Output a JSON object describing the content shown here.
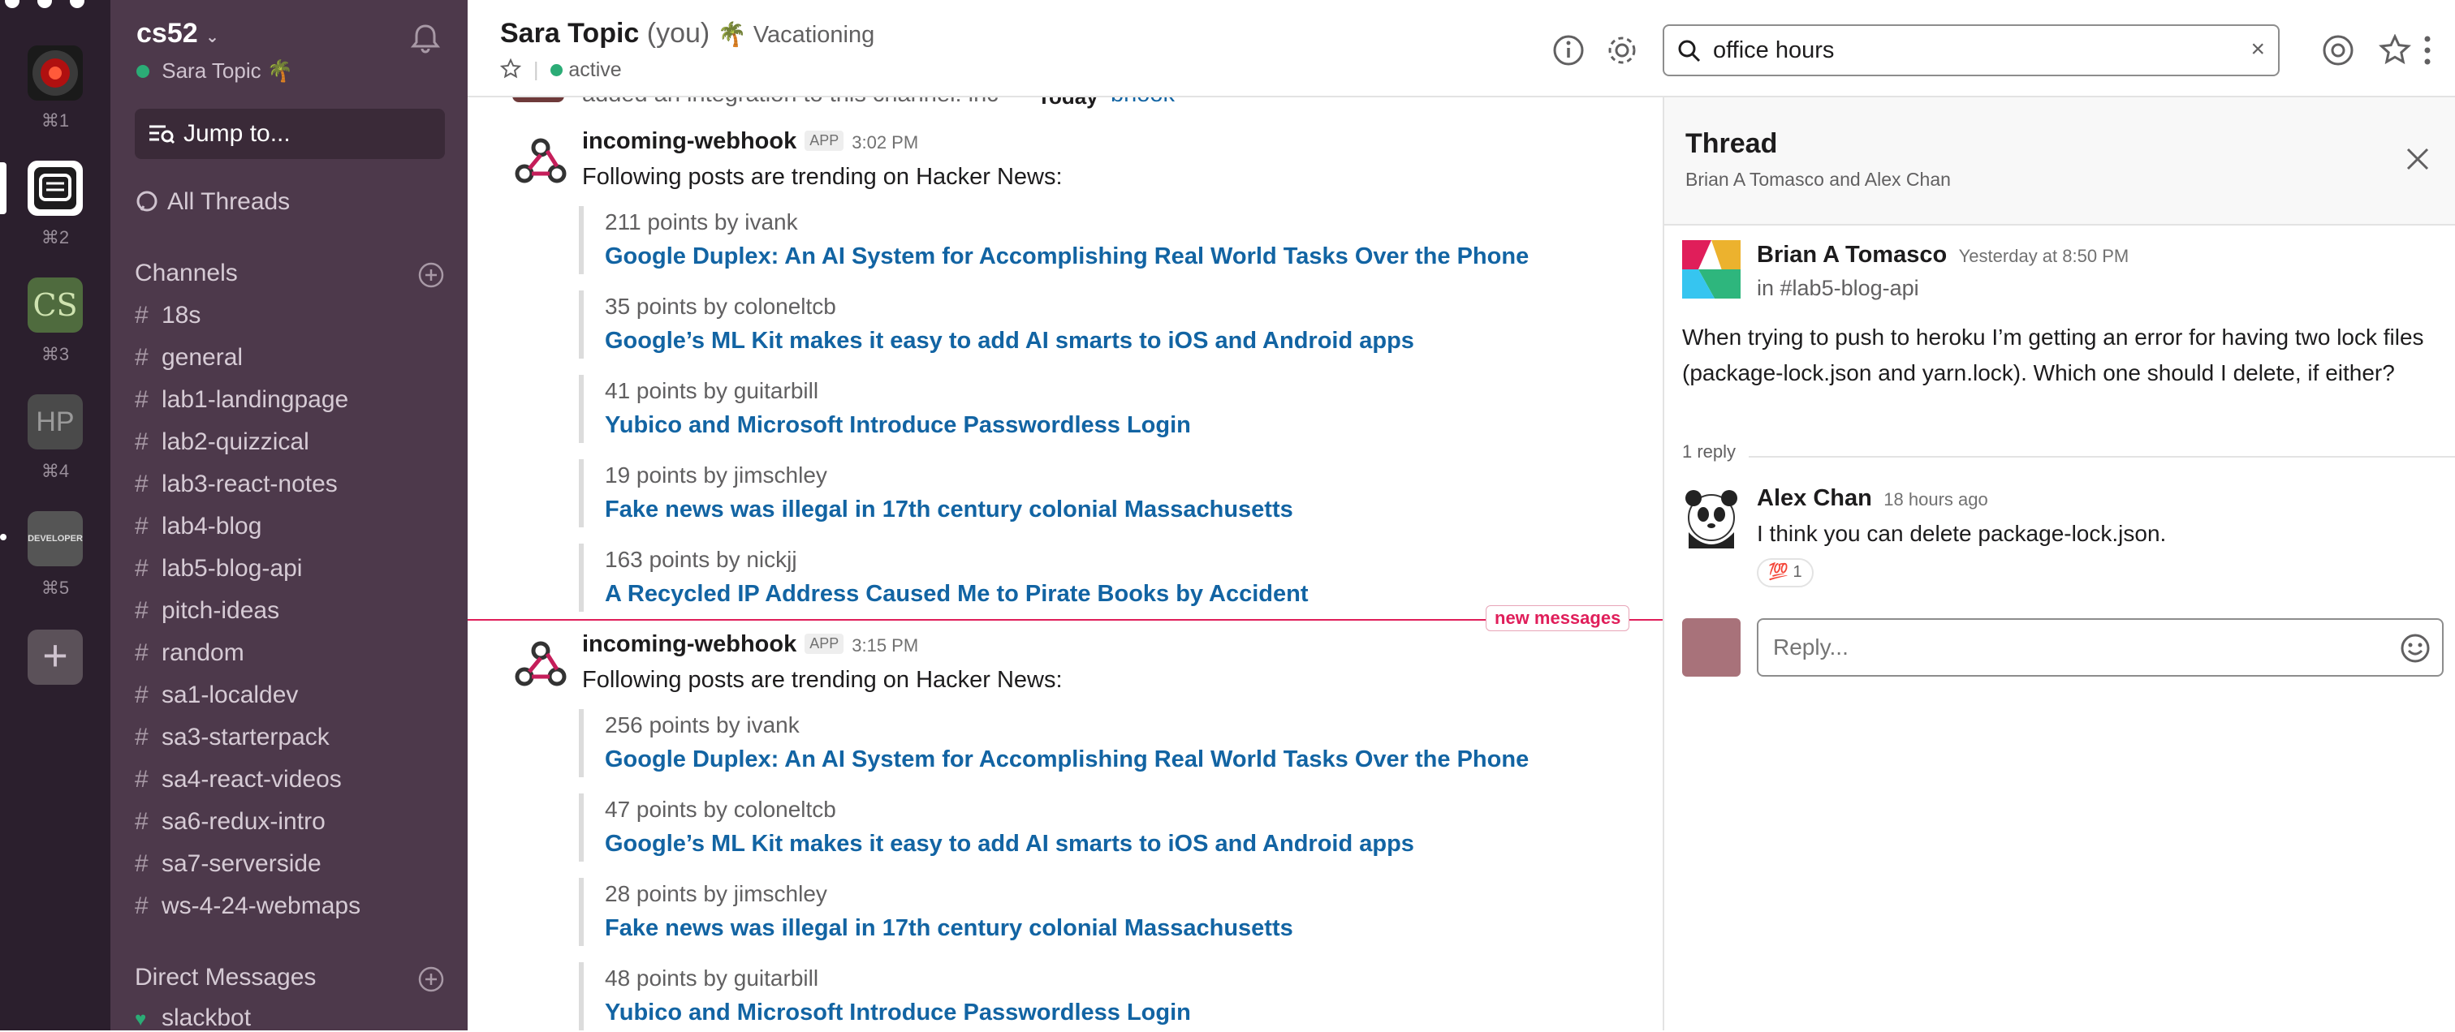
{
  "rail": {
    "workspaces": [
      {
        "shortcut": "⌘1",
        "label": ""
      },
      {
        "shortcut": "⌘2",
        "label": ""
      },
      {
        "shortcut": "⌘3",
        "label": "CS"
      },
      {
        "shortcut": "⌘4",
        "label": "HP"
      },
      {
        "shortcut": "⌘5",
        "label": "DEVELOPER"
      }
    ],
    "add_label": "+"
  },
  "sidebar": {
    "team": "cs52",
    "user": "Sara Topic 🌴",
    "jump_to": "Jump to...",
    "all_threads": "All Threads",
    "channels_header": "Channels",
    "channels": [
      "18s",
      "general",
      "lab1-landingpage",
      "lab2-quizzical",
      "lab3-react-notes",
      "lab4-blog",
      "lab5-blog-api",
      "pitch-ideas",
      "random",
      "sa1-localdev",
      "sa3-starterpack",
      "sa4-react-videos",
      "sa6-redux-intro",
      "sa7-serverside",
      "ws-4-24-webmaps"
    ],
    "dm_header": "Direct Messages",
    "dms": [
      "slackbot"
    ]
  },
  "header": {
    "name": "Sara Topic",
    "you": "(you)",
    "status": "🌴 Vacationing",
    "presence": "active",
    "search_value": "office hours"
  },
  "main": {
    "top_partial": "added an integration to this channel: inc",
    "top_partial_right": "bhook",
    "today": "Today",
    "new_messages": "new messages",
    "messages": [
      {
        "author": "incoming-webhook",
        "badge": "APP",
        "time": "3:02 PM",
        "text": "Following posts are trending on Hacker News:",
        "items": [
          {
            "by": "211 points by ivank",
            "title": "Google Duplex: An AI System for Accomplishing Real World Tasks Over the Phone"
          },
          {
            "by": "35 points by coloneltcb",
            "title": "Google’s ML Kit makes it easy to add AI smarts to iOS and Android apps"
          },
          {
            "by": "41 points by guitarbill",
            "title": "Yubico and Microsoft Introduce Passwordless Login"
          },
          {
            "by": "19 points by jimschley",
            "title": "Fake news was illegal in 17th century colonial Massachusetts"
          },
          {
            "by": "163 points by nickjj",
            "title": "A Recycled IP Address Caused Me to Pirate Books by Accident"
          }
        ]
      },
      {
        "author": "incoming-webhook",
        "badge": "APP",
        "time": "3:15 PM",
        "text": "Following posts are trending on Hacker News:",
        "items": [
          {
            "by": "256 points by ivank",
            "title": "Google Duplex: An AI System for Accomplishing Real World Tasks Over the Phone"
          },
          {
            "by": "47 points by coloneltcb",
            "title": "Google’s ML Kit makes it easy to add AI smarts to iOS and Android apps"
          },
          {
            "by": "28 points by jimschley",
            "title": "Fake news was illegal in 17th century colonial Massachusetts"
          },
          {
            "by": "48 points by guitarbill",
            "title": "Yubico and Microsoft Introduce Passwordless Login"
          }
        ]
      }
    ]
  },
  "thread": {
    "title": "Thread",
    "participants": "Brian A Tomasco and Alex Chan",
    "parent": {
      "author": "Brian A Tomasco",
      "time": "Yesterday at 8:50 PM",
      "channel": "in #lab5-blog-api",
      "text": "When trying to push to heroku I’m getting an error for having two lock files (package-lock.json and yarn.lock). Which one should I delete, if either?"
    },
    "reply_count": "1 reply",
    "reply": {
      "author": "Alex Chan",
      "time": "18 hours ago",
      "text": "I think you can delete package-lock.json.",
      "reaction_emoji": "💯",
      "reaction_count": "1"
    },
    "reply_placeholder": "Reply..."
  },
  "colors": {
    "sidebar": "#4d394b",
    "rail": "#2b1f2d",
    "link": "#1264a3",
    "new_messages": "#e01e5a",
    "presence": "#2bac76"
  }
}
